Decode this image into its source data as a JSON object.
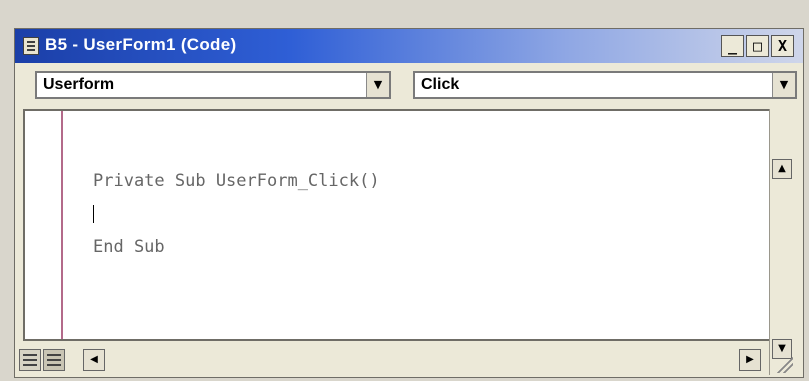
{
  "window": {
    "title": "B5 - UserForm1 (Code)",
    "buttons": {
      "minimize": "_",
      "maximize": "□",
      "close": "X"
    }
  },
  "object_combo": {
    "value": "Userform"
  },
  "procedure_combo": {
    "value": "Click"
  },
  "code": {
    "lines": [
      "Private Sub UserForm_Click()",
      "End Sub"
    ]
  },
  "colors": {
    "titlebar_start": "#1b3fa8",
    "margin_indicator": "#b36a8a"
  },
  "icons": {
    "window": "vba-module-icon",
    "dropdown": "chevron-down-icon",
    "scroll_up": "arrow-up-icon",
    "scroll_down": "arrow-down-icon",
    "scroll_left": "arrow-left-icon",
    "scroll_right": "arrow-right-icon",
    "procedure_view": "procedure-view-icon",
    "full_module_view": "full-module-view-icon",
    "resize": "resize-grip-icon"
  }
}
